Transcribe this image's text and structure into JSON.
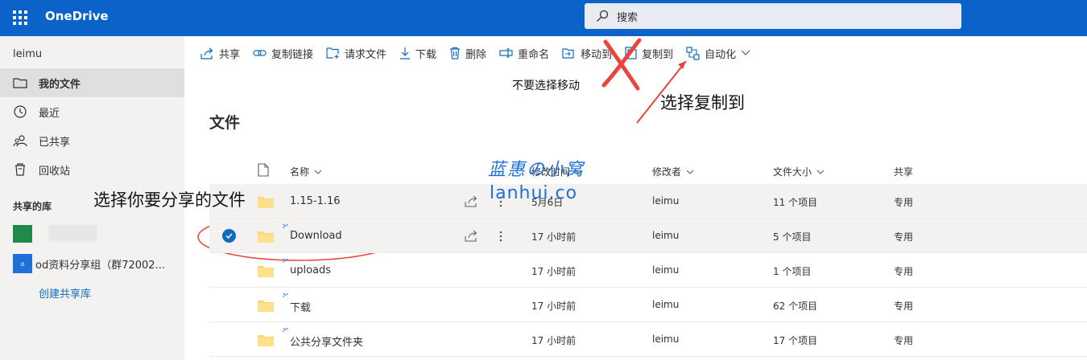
{
  "app": {
    "title": "OneDrive"
  },
  "search": {
    "placeholder": "搜索"
  },
  "user": {
    "name": "leimu"
  },
  "sidebar": {
    "items": [
      {
        "label": "我的文件"
      },
      {
        "label": "最近"
      },
      {
        "label": "已共享"
      },
      {
        "label": "回收站"
      }
    ],
    "shared_libraries_title": "共享的库",
    "library2_label": "od资料分享组（群72002...",
    "library2_icon_text": "o",
    "create_library": "创建共享库"
  },
  "toolbar": {
    "items": [
      {
        "label": "共享"
      },
      {
        "label": "复制链接"
      },
      {
        "label": "请求文件"
      },
      {
        "label": "下载"
      },
      {
        "label": "删除"
      },
      {
        "label": "重命名"
      },
      {
        "label": "移动到"
      },
      {
        "label": "复制到"
      },
      {
        "label": "自动化"
      }
    ]
  },
  "annotations": {
    "dont_move": "不要选择移动",
    "choose_copy": "选择复制到",
    "choose_file": "选择你要分享的文件"
  },
  "watermark": {
    "line1": "蓝惠の小窝",
    "line2": "lanhui.co"
  },
  "page": {
    "title": "文件"
  },
  "table": {
    "headers": {
      "name": "名称",
      "modified": "修改时间",
      "modified_by": "修改者",
      "size": "文件大小",
      "sharing": "共享"
    },
    "rows": [
      {
        "name": "1.15-1.16",
        "modified": "5月6日",
        "modified_by": "leimu",
        "size": "11 个项目",
        "sharing": "专用"
      },
      {
        "name": "Download",
        "modified": "17 小时前",
        "modified_by": "leimu",
        "size": "5 个项目",
        "sharing": "专用"
      },
      {
        "name": "uploads",
        "modified": "17 小时前",
        "modified_by": "leimu",
        "size": "1 个项目",
        "sharing": "专用"
      },
      {
        "name": "下载",
        "modified": "17 小时前",
        "modified_by": "leimu",
        "size": "62 个项目",
        "sharing": "专用"
      },
      {
        "name": "公共分享文件夹",
        "modified": "17 小时前",
        "modified_by": "leimu",
        "size": "17 个项目",
        "sharing": "专用"
      }
    ]
  },
  "colors": {
    "brand": "#0b63c9",
    "annotation_red": "#e8453c",
    "watermark": "#1e6fd9",
    "folder": "#f8d775"
  }
}
